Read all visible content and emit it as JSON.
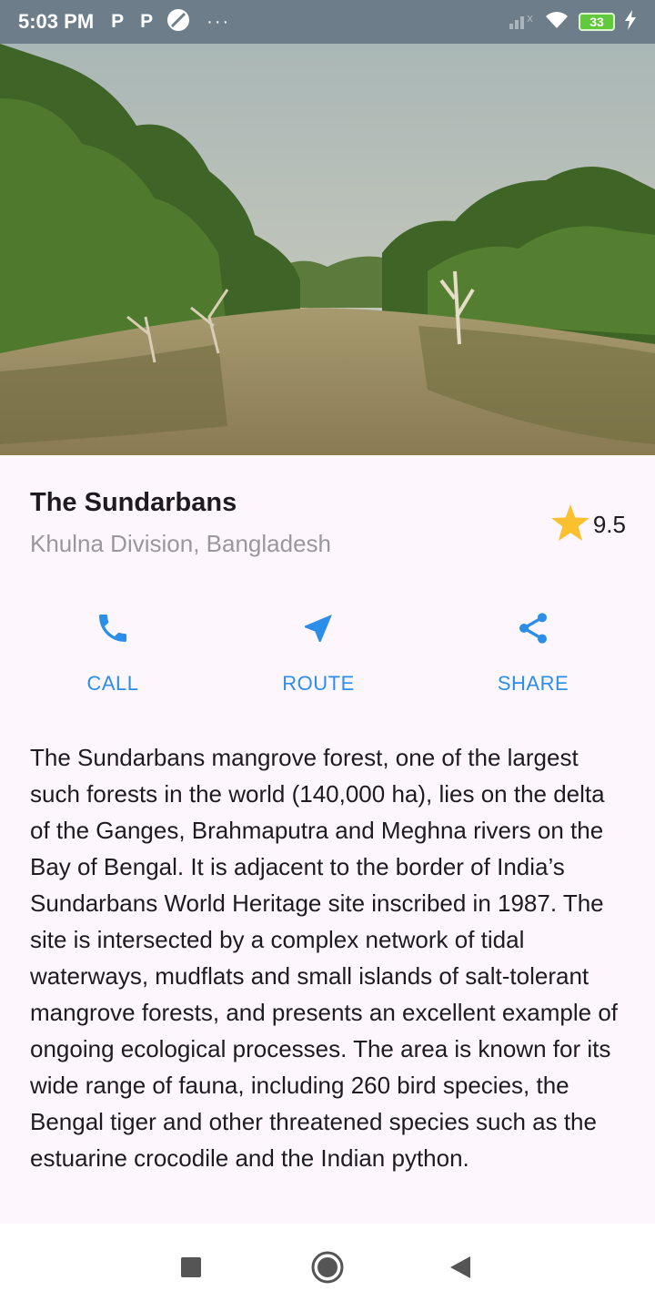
{
  "status_bar": {
    "time": "5:03 PM",
    "left_icons": [
      "parking-icon",
      "parking-icon",
      "no-sim-icon"
    ],
    "overflow": "···",
    "battery": "33",
    "right_icons": [
      "signal-icon",
      "wifi-icon",
      "battery-icon",
      "charging-icon"
    ]
  },
  "hero": {
    "image": "mangrove-river-photo"
  },
  "place": {
    "title": "The Sundarbans",
    "subtitle": "Khulna Division, Bangladesh",
    "rating": "9.5",
    "rating_icon": "star-icon",
    "rating_color": "#fbc02d"
  },
  "actions": [
    {
      "label": "CALL",
      "icon": "phone-icon"
    },
    {
      "label": "ROUTE",
      "icon": "navigation-icon"
    },
    {
      "label": "SHARE",
      "icon": "share-icon"
    }
  ],
  "accent_color": "#2c8ee8",
  "description": "The Sundarbans mangrove forest, one of the largest such forests in the world (140,000 ha), lies on the delta of the Ganges, Brahmaputra and Meghna rivers on the Bay of Bengal. It is adjacent to the border of India’s Sundarbans World Heritage site inscribed in 1987. The site is intersected by a complex network of tidal waterways, mudflats and small islands of salt-tolerant mangrove forests, and presents an excellent example of ongoing ecological processes. The area is known for its wide range of fauna, including 260 bird species, the Bengal tiger and other threatened species such as the estuarine crocodile and the Indian python.",
  "nav_bar": {
    "buttons": [
      "recent-apps-icon",
      "home-icon",
      "back-icon"
    ]
  }
}
